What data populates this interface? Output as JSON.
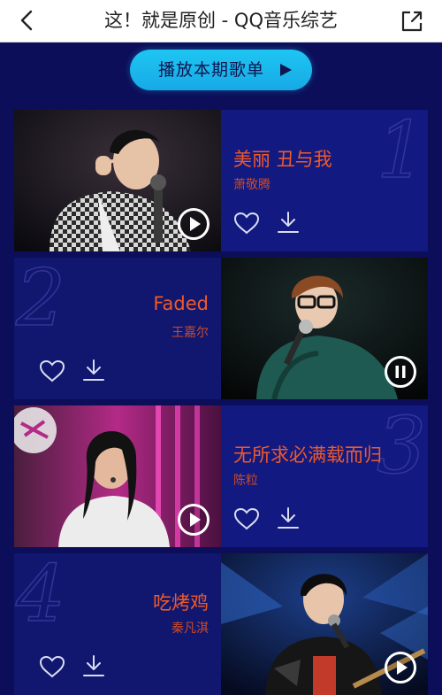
{
  "header": {
    "title": "这！就是原创 - QQ音乐综艺",
    "back_icon": "back-arrow-icon",
    "share_icon": "share-icon"
  },
  "play_all": {
    "label": "播放本期歌单",
    "icon": "play-triangle-icon"
  },
  "colors": {
    "background": "#0c0e5a",
    "card": "#121981",
    "title": "#ef5a2a",
    "artist": "#c94a28",
    "accent": "#1ec6f2"
  },
  "songs": [
    {
      "rank": "1",
      "title": "美丽 丑与我",
      "artist": "萧敬腾",
      "state": "play"
    },
    {
      "rank": "2",
      "title": "Faded",
      "artist": "王嘉尔",
      "state": "pause"
    },
    {
      "rank": "3",
      "title": "无所求必满载而归",
      "artist": "陈粒",
      "state": "play"
    },
    {
      "rank": "4",
      "title": "吃烤鸡",
      "artist": "秦凡淇",
      "state": "play"
    }
  ]
}
